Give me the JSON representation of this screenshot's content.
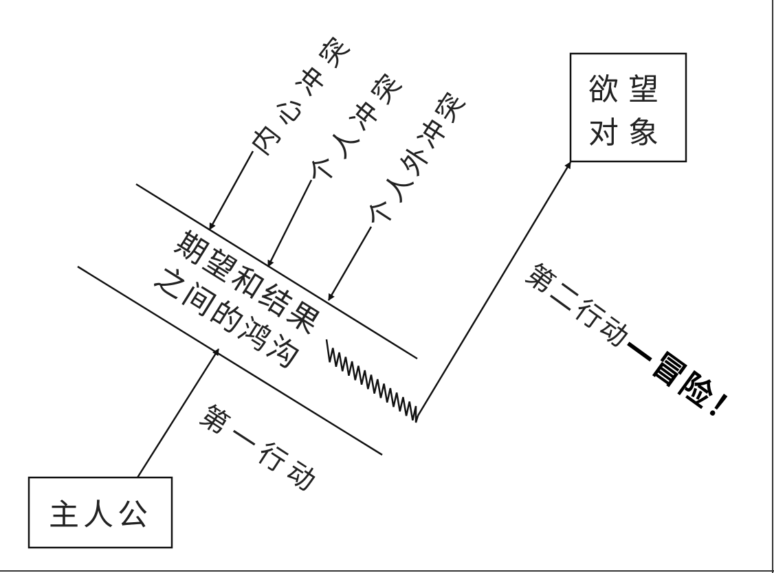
{
  "protagonist": "主人公",
  "desire_object": [
    "欲望",
    "对象"
  ],
  "gap": [
    "期望和结果",
    "之间的鸿沟"
  ],
  "conflicts": [
    "内心冲突",
    "个人冲突",
    "个人外冲突"
  ],
  "first_action": "第一行动",
  "second_action": "第二行动",
  "second_action_emphasis": "—冒险！",
  "colors": {
    "line": "#111111",
    "text": "#222222",
    "background": "#ffffff"
  }
}
